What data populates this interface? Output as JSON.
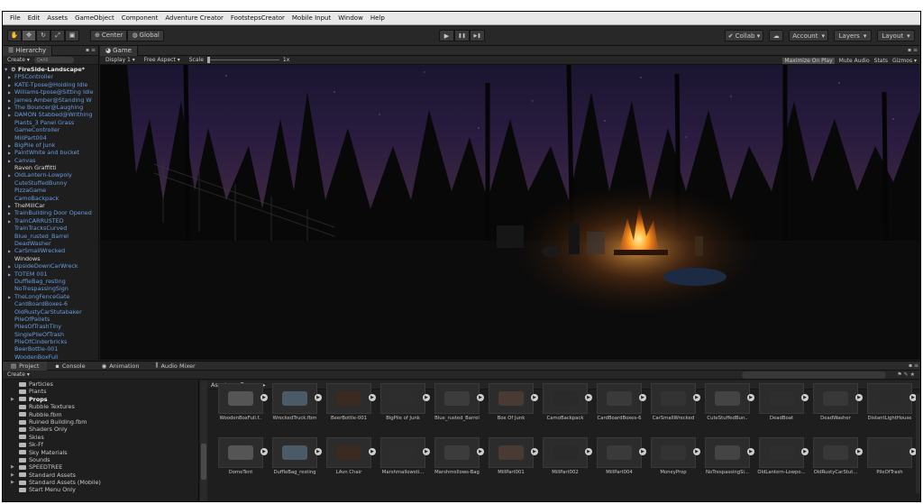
{
  "menubar": [
    "File",
    "Edit",
    "Assets",
    "GameObject",
    "Component",
    "Adventure Creator",
    "FootstepsCreator",
    "Mobile Input",
    "Window",
    "Help"
  ],
  "toolbar": {
    "center_label": "Center",
    "global_label": "Global",
    "play_icon": "▶",
    "pause_icon": "❚❚",
    "step_icon": "▶❚",
    "collab_label": "Collab ▾",
    "cloud_icon": "☁",
    "account_label": "Account",
    "layers_label": "Layers",
    "layout_label": "Layout"
  },
  "hierarchy": {
    "tab_label": "Hierarchy",
    "create_label": "Create ▾",
    "search_placeholder": "Q▾All",
    "root": "FireSide-Landscape*",
    "items": [
      {
        "label": "FPSController",
        "arrow": true,
        "color": "blue"
      },
      {
        "label": "KATE-Tpose@Holding Idle",
        "arrow": true,
        "color": "blue"
      },
      {
        "label": "Williams-tpose@Sitting Idle",
        "arrow": true,
        "color": "blue"
      },
      {
        "label": "James Amber@Standing W",
        "arrow": true,
        "color": "blue"
      },
      {
        "label": "The Bouncer@Laughing",
        "arrow": true,
        "color": "blue"
      },
      {
        "label": "DAMON Stabbed@Writhing",
        "arrow": true,
        "color": "blue"
      },
      {
        "label": "Plants_3 Panel Grass",
        "arrow": false,
        "color": "blue"
      },
      {
        "label": "GameController",
        "arrow": false,
        "color": "blue"
      },
      {
        "label": "MillPart004",
        "arrow": false,
        "color": "blue"
      },
      {
        "label": "BigPile of Junk",
        "arrow": true,
        "color": "blue"
      },
      {
        "label": "PaintWhite and bucket",
        "arrow": true,
        "color": "blue"
      },
      {
        "label": "Canvas",
        "arrow": true,
        "color": "blue"
      },
      {
        "label": "Raven Graffitti",
        "arrow": false,
        "color": "white"
      },
      {
        "label": "OldLantern-Lowpoly",
        "arrow": true,
        "color": "blue"
      },
      {
        "label": "CuteStuffedBunny",
        "arrow": false,
        "color": "blue"
      },
      {
        "label": "PizzaGame",
        "arrow": false,
        "color": "blue"
      },
      {
        "label": "CamoBackpack",
        "arrow": false,
        "color": "blue"
      },
      {
        "label": "TheMillCar",
        "arrow": true,
        "color": "white"
      },
      {
        "label": "TrainBuilding Door Opened",
        "arrow": true,
        "color": "blue"
      },
      {
        "label": "TrainCARRUSTED",
        "arrow": true,
        "color": "blue"
      },
      {
        "label": "TrainTracksCurved",
        "arrow": false,
        "color": "blue"
      },
      {
        "label": "Blue_rusted_Barrel",
        "arrow": false,
        "color": "blue"
      },
      {
        "label": "DeadWasher",
        "arrow": false,
        "color": "blue"
      },
      {
        "label": "CarSmallWrecked",
        "arrow": true,
        "color": "blue"
      },
      {
        "label": "Windows",
        "arrow": false,
        "color": "white"
      },
      {
        "label": "UpsideDownCarWreck",
        "arrow": true,
        "color": "blue"
      },
      {
        "label": "TOTEM 001",
        "arrow": true,
        "color": "blue"
      },
      {
        "label": "DuffleBag_resting",
        "arrow": false,
        "color": "blue"
      },
      {
        "label": "NoTrespassingSign",
        "arrow": false,
        "color": "blue"
      },
      {
        "label": "TheLongFenceGate",
        "arrow": true,
        "color": "blue"
      },
      {
        "label": "CardBoardBoxes-6",
        "arrow": false,
        "color": "blue"
      },
      {
        "label": "OldRustyCarStutabaker",
        "arrow": false,
        "color": "blue"
      },
      {
        "label": "PileOfPallets",
        "arrow": false,
        "color": "blue"
      },
      {
        "label": "PilesOfTrashTiny",
        "arrow": false,
        "color": "blue"
      },
      {
        "label": "SinglePileOfTrash",
        "arrow": false,
        "color": "blue"
      },
      {
        "label": "PileOfCinderbricks",
        "arrow": false,
        "color": "blue"
      },
      {
        "label": "BeerBottle-001",
        "arrow": false,
        "color": "blue"
      },
      {
        "label": "WoodenBoxFull",
        "arrow": false,
        "color": "blue"
      },
      {
        "label": "Fire Sparks",
        "arrow": false,
        "color": "blue"
      }
    ]
  },
  "game": {
    "tab_label": "Game",
    "display_label": "Display 1",
    "aspect_label": "Free Aspect",
    "scale_label": "Scale",
    "scale_value": "1x",
    "maximize_label": "Maximize On Play",
    "mute_label": "Mute Audio",
    "stats_label": "Stats",
    "gizmos_label": "Gizmos ▾"
  },
  "bottom_tabs": {
    "project": "Project",
    "console": "Console",
    "animation": "Animation",
    "audio_mixer": "Audio Mixer"
  },
  "project": {
    "create_label": "Create ▾",
    "tree": [
      {
        "label": "Particles",
        "expanded": false
      },
      {
        "label": "Plants",
        "expanded": false
      },
      {
        "label": "Props",
        "expanded": true,
        "selected": true
      },
      {
        "label": "Rubble Textures",
        "expanded": false
      },
      {
        "label": "Rubble.fbm",
        "expanded": false
      },
      {
        "label": "Ruined Building.fbm",
        "expanded": false
      },
      {
        "label": "Shaders Only",
        "expanded": false
      },
      {
        "label": "Skies",
        "expanded": false
      },
      {
        "label": "Sk-Ff",
        "expanded": false
      },
      {
        "label": "Sky Materials",
        "expanded": false
      },
      {
        "label": "Sounds",
        "expanded": false
      },
      {
        "label": "SPEEDTREE",
        "expanded": true
      },
      {
        "label": "Standard Assets",
        "expanded": true
      },
      {
        "label": "Standard Assets (Mobile)",
        "expanded": true
      },
      {
        "label": "Start Menu Only",
        "expanded": false
      }
    ],
    "breadcrumb": {
      "root": "Assets",
      "current": "Props"
    },
    "assets_row1": [
      "WoodenBoxFull.f..",
      "WreckedTruck.fbm",
      "BeerBottle-001",
      "BigPile of Junk",
      "Blue_rusted_Barrel",
      "Box Of Junk",
      "CamoBackpack",
      "CardBoardBoxes-6",
      "CarSmallWrecked",
      "CuteStuffedBun..",
      "DeadBoat",
      "DeadWasher",
      "DistantLightHouse"
    ],
    "assets_row2": [
      "DomeTent",
      "DuffleBag_resting",
      "LAvn Chair",
      "Marshmallowsti...",
      "Marshmellows-Bag",
      "MillPart001",
      "MillPart002",
      "MillPart004",
      "MoneyProp",
      "NoTrespassingSi...",
      "OldLantern-Lowpo...",
      "OldRustyCarStut...",
      "PileOfTrash"
    ]
  },
  "colors": {
    "accent": "#3d6fb6",
    "hierarchy_blue": "#6a9be0",
    "fire": "#ff8a1e"
  }
}
